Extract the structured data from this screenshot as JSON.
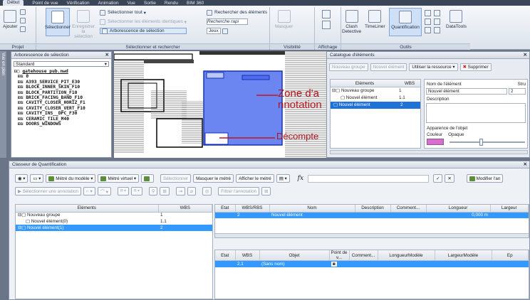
{
  "menu": {
    "tabs": [
      "Début",
      "Point de vue",
      "Vérification",
      "Animation",
      "Vue",
      "Sortie",
      "Rendu",
      "BIM 360"
    ]
  },
  "ribbon": {
    "ajouter": "Ajouter",
    "selectionner": "Sélectionner",
    "enregistrer": "Enregistrer\nla sélection",
    "sel_tout": "Sélectionner tout",
    "sel_identiques": "Sélectionner les éléments identiques",
    "arborescence": "Arborescence de sélection",
    "rechercher": "Rechercher des éléments",
    "recherche_rapide": "Recherche rapi",
    "jeux": "Jeux",
    "masquer": "Masquer",
    "clash": "Clash\nDetective",
    "timeliner": "TimeLiner",
    "quantification": "Quantification",
    "datatools": "DataTools",
    "groups": [
      "Projet",
      "Sélectionner et rechercher",
      "Visibilité",
      "Affichage",
      "Outils"
    ]
  },
  "left_tab": "Vue en plan",
  "selection_tree": {
    "title": "Arborescence de sélection",
    "dropdown": "Standard",
    "items": [
      "gatehouse_pub.nwd",
      "0",
      "A393_SERVICE_PIT_E30",
      "BLOCK_INNER_SKIN_F10",
      "BLOCK_PARTITION_F10",
      "BRICK_FACING_BAND_F10",
      "CAVITY_CLOSER_HORIZ_F1",
      "CAVITY_CLOSER_VERT_F10",
      "CAVITY_INS__DPC_F30",
      "CERAMIC_TILE_M40",
      "DOORS_WINDOWS"
    ]
  },
  "annotations": {
    "zone": "Zone d'a\nnnotation",
    "decompte": "Décompte"
  },
  "catalog": {
    "title": "Catalogue d'éléments",
    "btn_nouveau_groupe": "Nouveau groupe",
    "btn_nouvel_element": "Nouvel élément",
    "btn_utiliser": "Utiliser la ressource",
    "btn_supprimer": "Supprimer",
    "col_elements": "Eléments",
    "col_wbs": "WBS",
    "rows": [
      {
        "name": "Nouveau groupe",
        "wbs": "1"
      },
      {
        "name": "Nouvel élément",
        "wbs": "1.1"
      },
      {
        "name": "Nouvel élément",
        "wbs": "2"
      }
    ],
    "nom_label": "Nom de l'élément",
    "stru_label": "Stru",
    "nom_value": "Nouvel élément",
    "stru_value": "2",
    "description": "Description",
    "apparence": "Apparence de l'objet",
    "couleur": "Couleur",
    "opaque": "Opaque"
  },
  "quant": {
    "title": "Classeur de Quantification",
    "toolbar1": [
      "Métré du modèle",
      "Métré virtuel",
      "Sélectionner",
      "Masquer le métré",
      "Afficher le métré",
      "Modifier l'an"
    ],
    "toolbar2": [
      "Sélectionner une annotation",
      "Filtrer l'annotation"
    ],
    "left_cols": [
      "Eléments",
      "WBS"
    ],
    "left_rows": [
      {
        "name": "Nouveau groupe",
        "wbs": "1"
      },
      {
        "name": "Nouvel élément(0)",
        "wbs": "1.1"
      },
      {
        "name": "Nouvel élément(1)",
        "wbs": "2"
      }
    ],
    "top_cols": [
      "Etat",
      "WBS/RBS",
      "Nom",
      "Description",
      "Comment...",
      "Longueur",
      "Largeur"
    ],
    "top_row": {
      "wbs": "2",
      "nom": "Nouvel élément",
      "longueur": "0,000 m"
    },
    "bot_cols": [
      "Etat",
      "WBS",
      "Objet",
      "Point de v...",
      "Comment...",
      "LongueurModèle",
      "LargeurModèle",
      "Ep"
    ],
    "bot_row": {
      "wbs": "2.1",
      "objet": "(Sans nom)"
    },
    "fx": "fx"
  }
}
